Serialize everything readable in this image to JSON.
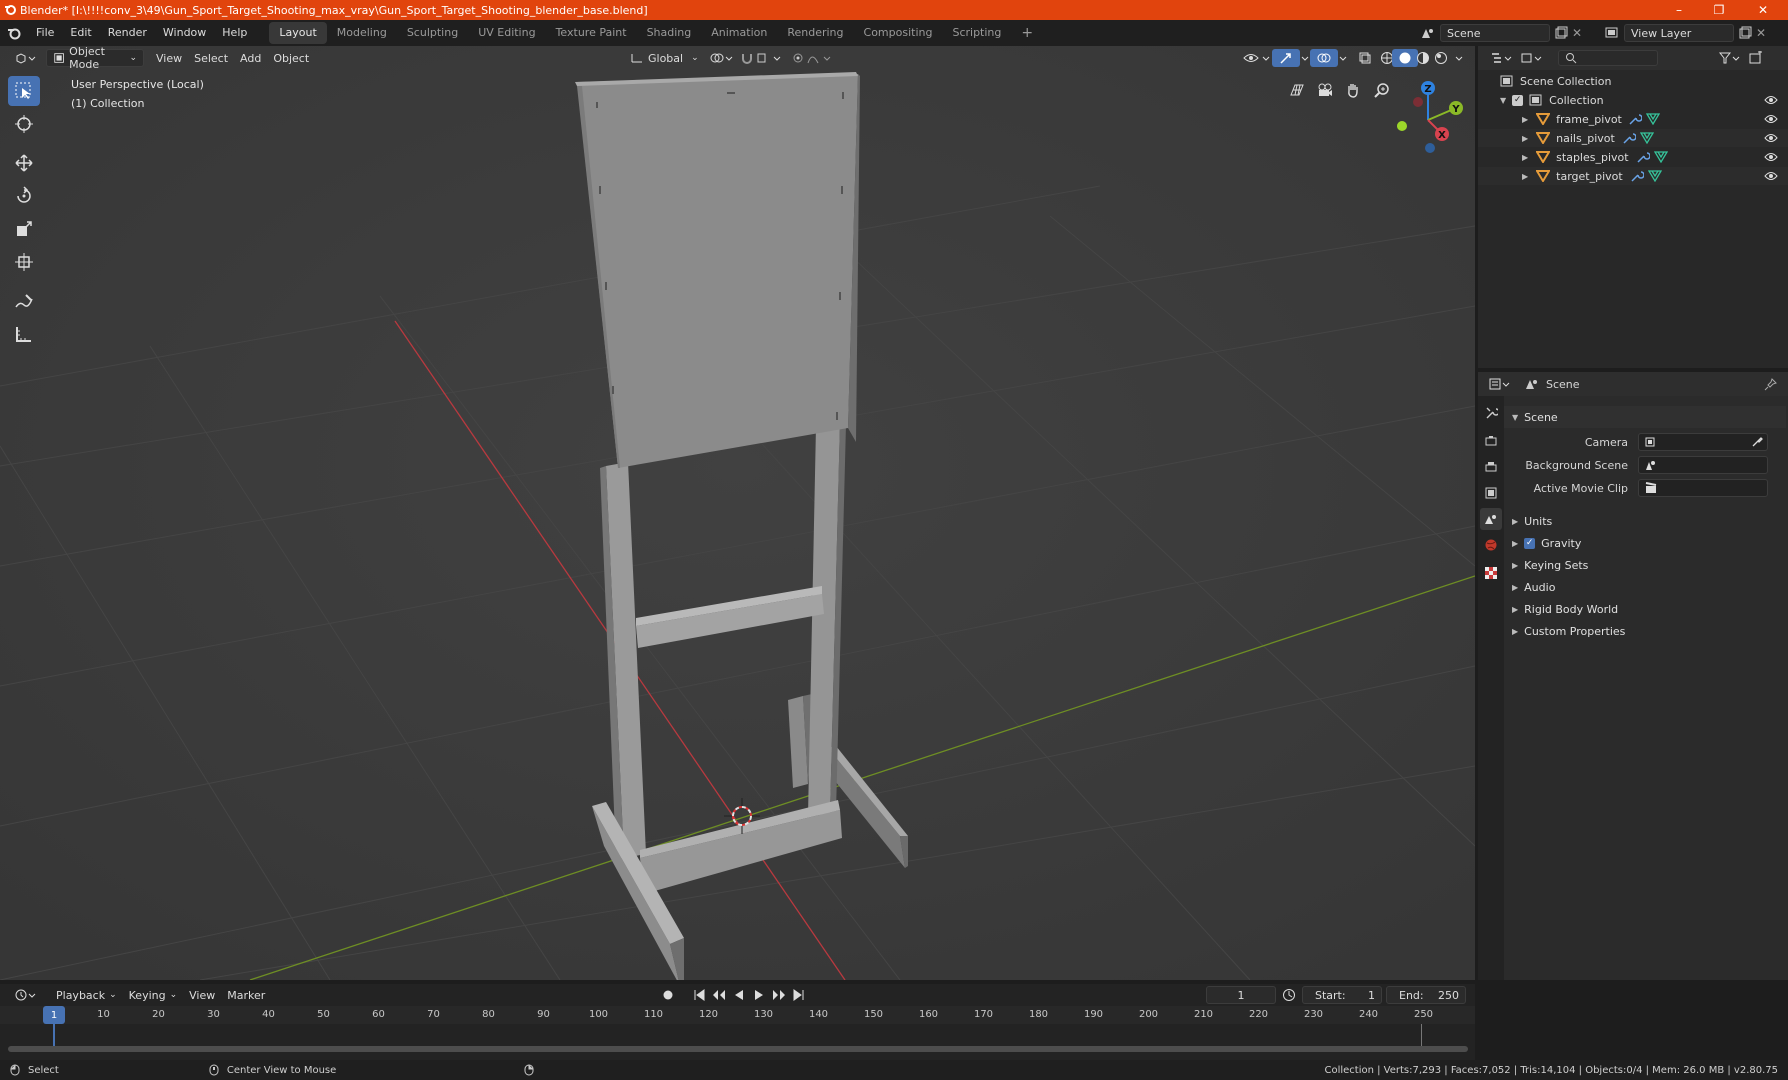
{
  "window": {
    "title": "Blender* [I:\\!!!!conv_3\\49\\Gun_Sport_Target_Shooting_max_vray\\Gun_Sport_Target_Shooting_blender_base.blend]",
    "controls": [
      "–",
      "❐",
      "✕"
    ]
  },
  "menus": [
    "File",
    "Edit",
    "Render",
    "Window",
    "Help"
  ],
  "workspace_tabs": [
    "Layout",
    "Modeling",
    "Sculpting",
    "UV Editing",
    "Texture Paint",
    "Shading",
    "Animation",
    "Rendering",
    "Compositing",
    "Scripting"
  ],
  "active_workspace": "Layout",
  "scene_field": "Scene",
  "view_layer_field": "View Layer",
  "viewport": {
    "mode": "Object Mode",
    "menus": [
      "View",
      "Select",
      "Add",
      "Object"
    ],
    "transform_orientation": "Global",
    "overlay_line1": "User Perspective (Local)",
    "overlay_line2": "(1) Collection",
    "gizmo_labels": {
      "z": "Z",
      "y": "Y",
      "x": "X"
    }
  },
  "outliner": {
    "root": "Scene Collection",
    "collection": "Collection",
    "items": [
      "frame_pivot",
      "nails_pivot",
      "staples_pivot",
      "target_pivot"
    ]
  },
  "properties": {
    "header": "Scene",
    "panel": "Scene",
    "fields": [
      {
        "label": "Camera",
        "value": ""
      },
      {
        "label": "Background Scene",
        "value": ""
      },
      {
        "label": "Active Movie Clip",
        "value": ""
      }
    ],
    "sections": [
      "Units",
      "Gravity",
      "Keying Sets",
      "Audio",
      "Rigid Body World",
      "Custom Properties"
    ],
    "gravity_checked": true
  },
  "timeline": {
    "menus": [
      "Playback",
      "Keying",
      "View",
      "Marker"
    ],
    "current_frame": "1",
    "start_label": "Start:",
    "start": "1",
    "end_label": "End:",
    "end": "250",
    "ticks": [
      "1",
      "10",
      "20",
      "30",
      "40",
      "50",
      "60",
      "70",
      "80",
      "90",
      "100",
      "110",
      "120",
      "130",
      "140",
      "150",
      "160",
      "170",
      "180",
      "190",
      "200",
      "210",
      "220",
      "230",
      "240",
      "250"
    ]
  },
  "statusbar": {
    "left": "Select",
    "middle": "Center View to Mouse",
    "right": "Collection | Verts:7,293 | Faces:7,052 | Tris:14,104 | Objects:0/4 | Mem: 26.0 MB | v2.80.75"
  },
  "colors": {
    "title_bar": "#e1440d",
    "accent": "#4772b3",
    "x_axis": "#d8434f",
    "y_axis": "#8bb927",
    "z_axis": "#2e82e0",
    "object_icon": "#e59b3a"
  }
}
